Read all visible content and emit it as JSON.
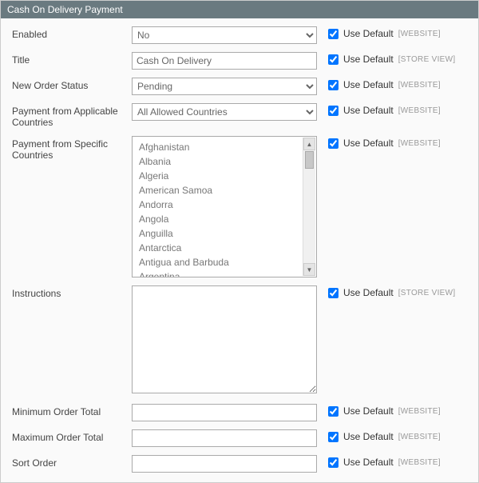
{
  "header": {
    "title": "Cash On Delivery Payment"
  },
  "common": {
    "use_default_label": "Use Default",
    "scope_website": "[WEBSITE]",
    "scope_storeview": "[STORE VIEW]"
  },
  "fields": {
    "enabled": {
      "label": "Enabled",
      "value": "No",
      "scope": "website"
    },
    "title": {
      "label": "Title",
      "value": "Cash On Delivery",
      "scope": "storeview"
    },
    "new_order_status": {
      "label": "New Order Status",
      "value": "Pending",
      "scope": "website"
    },
    "allow_countries": {
      "label": "Payment from Applicable Countries",
      "value": "All Allowed Countries",
      "scope": "website"
    },
    "specific_countries": {
      "label": "Payment from Specific Countries",
      "scope": "website",
      "options": [
        "Afghanistan",
        "Albania",
        "Algeria",
        "American Samoa",
        "Andorra",
        "Angola",
        "Anguilla",
        "Antarctica",
        "Antigua and Barbuda",
        "Argentina"
      ]
    },
    "instructions": {
      "label": "Instructions",
      "value": "",
      "scope": "storeview"
    },
    "min_order_total": {
      "label": "Minimum Order Total",
      "value": "",
      "scope": "website"
    },
    "max_order_total": {
      "label": "Maximum Order Total",
      "value": "",
      "scope": "website"
    },
    "sort_order": {
      "label": "Sort Order",
      "value": "",
      "scope": "website"
    }
  }
}
